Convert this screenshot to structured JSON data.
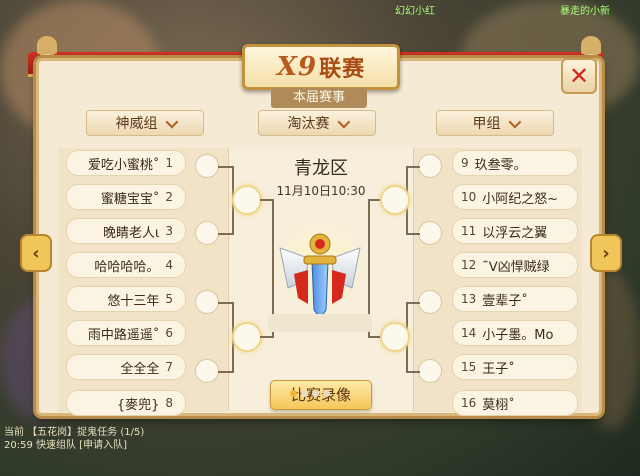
{
  "header": {
    "banner_prefix": "X9",
    "banner_title": "联赛",
    "subtitle": "本届赛事"
  },
  "filters": {
    "group": "神威组",
    "stage": "淘汰赛",
    "division": "甲组"
  },
  "bracket": {
    "zone": "青龙区",
    "time": "11月10日10:30",
    "replay_label": "比赛录像",
    "left_players": [
      {
        "name": "爱吃小蜜桃˚",
        "seed": "1"
      },
      {
        "name": "蜜糖宝宝˚",
        "seed": "2"
      },
      {
        "name": "晚睛老人ι",
        "seed": "3"
      },
      {
        "name": "哈哈哈哈。",
        "seed": "4"
      },
      {
        "name": "悠十三年",
        "seed": "5"
      },
      {
        "name": "雨中路遥遥˚",
        "seed": "6"
      },
      {
        "name": "全全全",
        "seed": "7"
      },
      {
        "name": "{麥兜}",
        "seed": "8"
      }
    ],
    "right_players": [
      {
        "name": "玖叁零。",
        "seed": "9"
      },
      {
        "name": "小阿纪之怒~",
        "seed": "10"
      },
      {
        "name": "以浮云之翼",
        "seed": "11"
      },
      {
        "name": "˜ᐯ凶悍贼绿",
        "seed": "12"
      },
      {
        "name": "壹辈子˚",
        "seed": "13"
      },
      {
        "name": "小子墨。Mo",
        "seed": "14"
      },
      {
        "name": "王子˚",
        "seed": "15"
      },
      {
        "name": "莫栩˚",
        "seed": "16"
      }
    ]
  },
  "game": {
    "chat_line1": "当前 【五花岗】捉鬼任务 (1/5)",
    "chat_line2": "20:59 快速组队 [申请入队]",
    "top_text_left": "幻幻小红",
    "top_text_right": "暴走的小新"
  },
  "colors": {
    "accent_red": "#d2291c",
    "gold": "#f3b63b"
  }
}
